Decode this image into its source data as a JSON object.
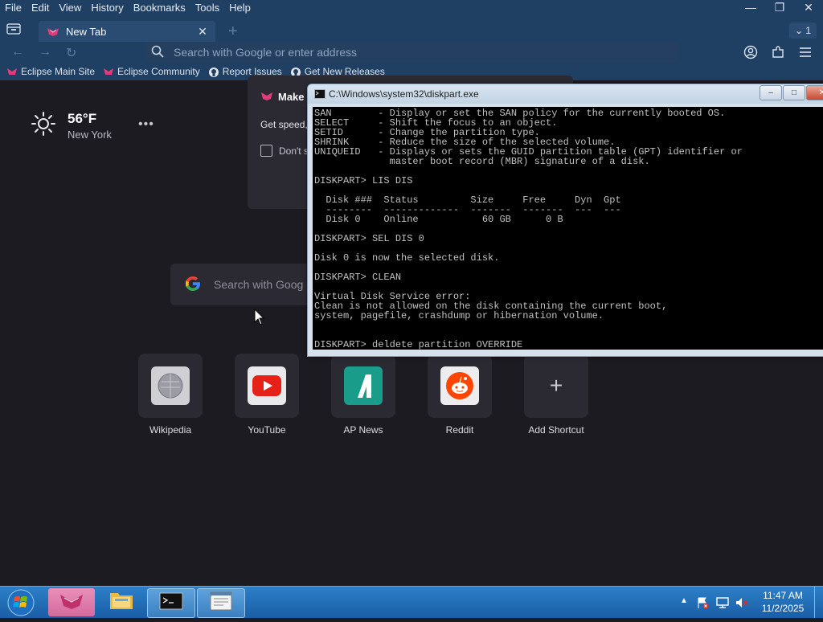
{
  "browser": {
    "menu": [
      "File",
      "Edit",
      "View",
      "History",
      "Bookmarks",
      "Tools",
      "Help"
    ],
    "tab": {
      "title": "New Tab"
    },
    "tab_count": "1",
    "address_placeholder": "Search with Google or enter address",
    "bookmarks": [
      "Eclipse Main Site",
      "Eclipse Community",
      "Report Issues",
      "Get New Releases"
    ],
    "colors": {
      "chrome": "#1f3f63",
      "page": "#1c1b22"
    }
  },
  "newtab": {
    "weather": {
      "temp": "56°F",
      "location": "New York",
      "icon": "sun-icon"
    },
    "promo": {
      "heading": "Make F",
      "body": "Get speed,",
      "checkbox_label": "Don't s"
    },
    "search_placeholder": "Search with Goog",
    "shortcuts": [
      {
        "label": "Wikipedia",
        "icon": "wikipedia-icon"
      },
      {
        "label": "YouTube",
        "icon": "youtube-icon"
      },
      {
        "label": "AP News",
        "icon": "apnews-icon"
      },
      {
        "label": "Reddit",
        "icon": "reddit-icon"
      },
      {
        "label": "Add Shortcut",
        "icon": "plus-icon"
      }
    ]
  },
  "console": {
    "title": "C:\\Windows\\system32\\diskpart.exe",
    "text": "SAN        - Display or set the SAN policy for the currently booted OS.\nSELECT     - Shift the focus to an object.\nSETID      - Change the partition type.\nSHRINK     - Reduce the size of the selected volume.\nUNIQUEID   - Displays or sets the GUID partition table (GPT) identifier or\n             master boot record (MBR) signature of a disk.\n\nDISKPART> LIS DIS\n\n  Disk ###  Status         Size     Free     Dyn  Gpt\n  --------  -------------  -------  -------  ---  ---\n  Disk 0    Online           60 GB      0 B\n\nDISKPART> SEL DIS 0\n\nDisk 0 is now the selected disk.\n\nDISKPART> CLEAN\n\nVirtual Disk Service error:\nClean is not allowed on the disk containing the current boot,\nsystem, pagefile, crashdump or hibernation volume.\n\n\nDISKPART> deldete partition OVERRIDE"
  },
  "taskbar": {
    "time": "11:47 AM",
    "date": "11/2/2025"
  }
}
